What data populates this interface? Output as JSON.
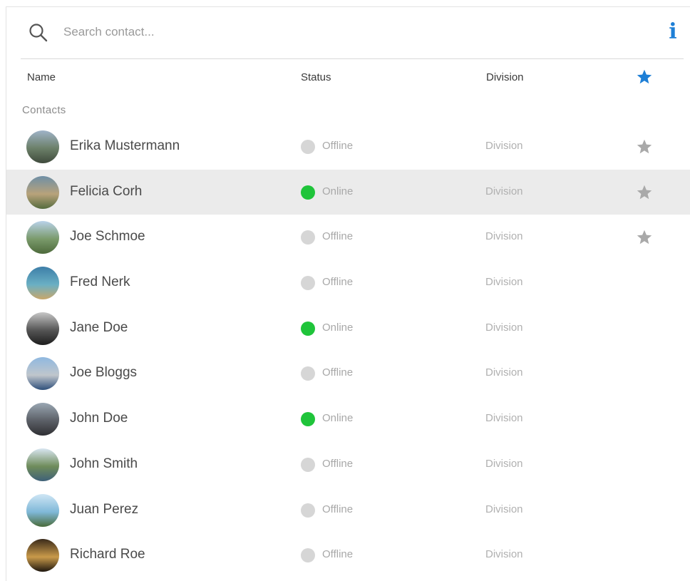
{
  "search": {
    "placeholder": "Search contact..."
  },
  "columns": {
    "name": "Name",
    "status": "Status",
    "division": "Division"
  },
  "section_label": "Contacts",
  "colors": {
    "online": "#1fc43a",
    "offline": "#d6d6d6",
    "accent": "#1e7fd6",
    "star": "#a9a9a9",
    "selected_row": "#ebebeb"
  },
  "contacts": [
    {
      "name": "Erika Mustermann",
      "status": "Offline",
      "online": false,
      "division": "Division",
      "favorite": true,
      "selected": false,
      "avatar": [
        "#9fb3c8",
        "#6b7f68",
        "#3f4a3c"
      ]
    },
    {
      "name": "Felicia Corh",
      "status": "Online",
      "online": true,
      "division": "Division",
      "favorite": true,
      "selected": true,
      "avatar": [
        "#6f8fa6",
        "#b8a27a",
        "#556b3e"
      ]
    },
    {
      "name": "Joe Schmoe",
      "status": "Offline",
      "online": false,
      "division": "Division",
      "favorite": true,
      "selected": false,
      "avatar": [
        "#b9d2ea",
        "#7a9a6b",
        "#4d6a3b"
      ]
    },
    {
      "name": "Fred Nerk",
      "status": "Offline",
      "online": false,
      "division": "Division",
      "favorite": false,
      "selected": false,
      "avatar": [
        "#3d7ea8",
        "#6ab0c4",
        "#c9a76a"
      ]
    },
    {
      "name": "Jane Doe",
      "status": "Online",
      "online": true,
      "division": "Division",
      "favorite": false,
      "selected": false,
      "avatar": [
        "#c7c7c7",
        "#555555",
        "#1d1d1d"
      ]
    },
    {
      "name": "Joe Bloggs",
      "status": "Offline",
      "online": false,
      "division": "Division",
      "favorite": false,
      "selected": false,
      "avatar": [
        "#8fb8e0",
        "#c0c6cc",
        "#2e4f7a"
      ]
    },
    {
      "name": "John Doe",
      "status": "Online",
      "online": true,
      "division": "Division",
      "favorite": false,
      "selected": false,
      "avatar": [
        "#9aa7b3",
        "#5b5f66",
        "#2f2f33"
      ]
    },
    {
      "name": "John Smith",
      "status": "Offline",
      "online": false,
      "division": "Division",
      "favorite": false,
      "selected": false,
      "avatar": [
        "#d9e6f2",
        "#6f8c5a",
        "#3e6078"
      ]
    },
    {
      "name": "Juan Perez",
      "status": "Offline",
      "online": false,
      "division": "Division",
      "favorite": false,
      "selected": false,
      "avatar": [
        "#cfe6f5",
        "#7fb8d8",
        "#4a6b3a"
      ]
    },
    {
      "name": "Richard Roe",
      "status": "Offline",
      "online": false,
      "division": "Division",
      "favorite": false,
      "selected": false,
      "avatar": [
        "#3a2a1a",
        "#c99a4a",
        "#1e160e"
      ]
    }
  ]
}
